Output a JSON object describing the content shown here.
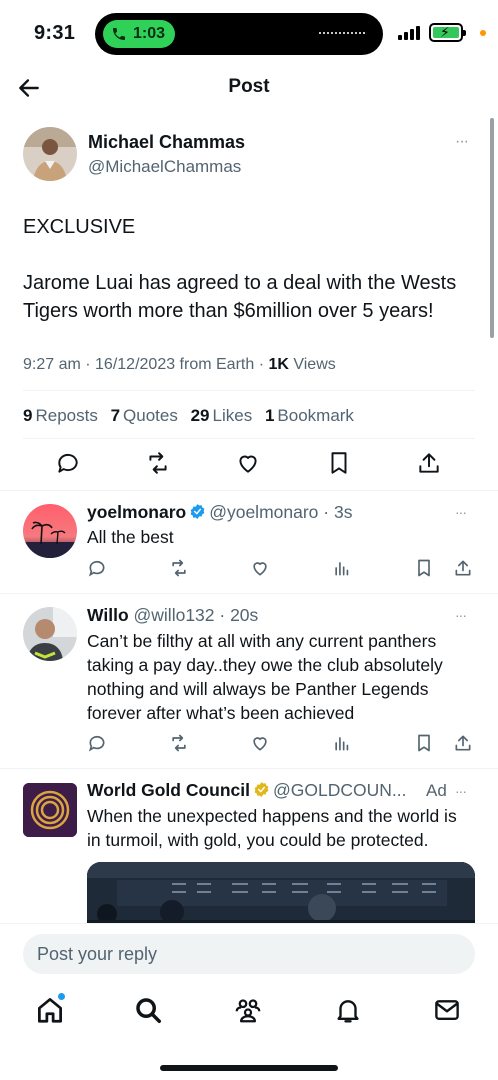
{
  "status_bar": {
    "time": "9:31",
    "call_duration": "1:03",
    "battery_icon": "battery-charging-icon"
  },
  "header": {
    "title": "Post",
    "back_icon": "back-arrow-icon"
  },
  "post": {
    "author_name": "Michael Chammas",
    "author_handle": "@MichaelChammas",
    "text": "EXCLUSIVE\n\nJarome Luai has agreed to a deal with the Wests Tigers worth more than $6million over 5 years!",
    "timestamp": "9:27 am · 16/12/2023 from Earth · ",
    "views_count": "1K",
    "views_label": " Views",
    "reposts_count": "9",
    "reposts_label": "Reposts",
    "quotes_count": "7",
    "quotes_label": "Quotes",
    "likes_count": "29",
    "likes_label": "Likes",
    "bookmarks_count": "1",
    "bookmarks_label": "Bookmark",
    "more": "···"
  },
  "replies": [
    {
      "name": "yoelmonaro",
      "verified": true,
      "handle": "@yoelmonaro",
      "time": " · 3s",
      "text": "All the best",
      "more": "···"
    },
    {
      "name": "Willo",
      "verified": false,
      "handle": "@willo132",
      "time": " · 20s",
      "text": "Can’t be filthy at all with any current panthers taking a pay day..they owe the club absolutely nothing and will always be Panther Legends forever after what’s been achieved",
      "more": "···"
    },
    {
      "name": "World Gold Council",
      "verified": true,
      "verified_color": "#e2b719",
      "handle": "@GOLDCOUN...",
      "ad_label": "Ad",
      "text": "When the unexpected happens and the world is in turmoil, with gold, you could be protected.",
      "more": "···"
    }
  ],
  "composer": {
    "placeholder": "Post your reply"
  },
  "tabbar": [
    "home-icon",
    "search-icon",
    "communities-icon",
    "notifications-icon",
    "messages-icon"
  ],
  "colors": {
    "accent": "#1d9bf0",
    "text": "#0f1419",
    "secondary": "#536471",
    "call_green": "#30d158"
  }
}
